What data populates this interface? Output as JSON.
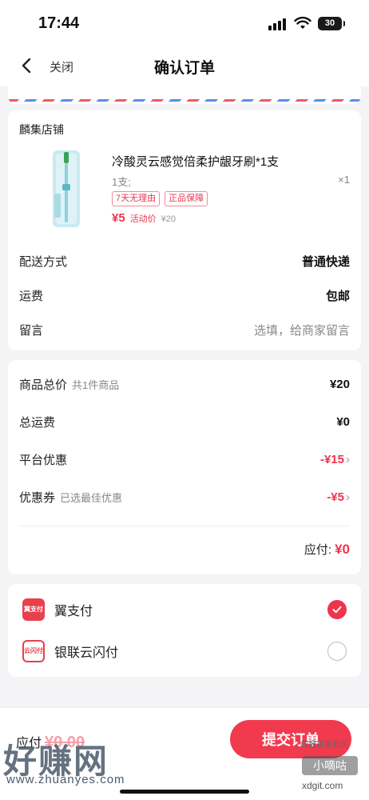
{
  "status_bar": {
    "time": "17:44",
    "battery": "30"
  },
  "nav": {
    "close_label": "关闭",
    "title": "确认订单"
  },
  "shop": {
    "name": "麟集店铺",
    "product": {
      "title": "冷酸灵云感觉倍柔护龈牙刷*1支",
      "spec": "1支;",
      "qty": "×1",
      "tags": [
        "7天无理由",
        "正品保障"
      ],
      "price": "¥5",
      "price_label": "活动价",
      "original_price": "¥20"
    },
    "delivery_label": "配送方式",
    "delivery_value": "普通快递",
    "shipping_label": "运费",
    "shipping_value": "包邮",
    "message_label": "留言",
    "message_placeholder": "选填，给商家留言"
  },
  "summary": {
    "goods_total_label": "商品总价",
    "goods_total_note": "共1件商品",
    "goods_total_value": "¥20",
    "shipping_total_label": "总运费",
    "shipping_total_value": "¥0",
    "platform_discount_label": "平台优惠",
    "platform_discount_value": "-¥15",
    "coupon_label": "优惠券",
    "coupon_note": "已选最佳优惠",
    "coupon_value": "-¥5",
    "due_label": "应付:",
    "due_value": "¥0"
  },
  "payment": {
    "methods": [
      {
        "name": "翼支付",
        "logo": "翼支付",
        "selected": true
      },
      {
        "name": "银联云闪付",
        "logo": "云闪付",
        "selected": false
      }
    ]
  },
  "bottom": {
    "due_label": "应付",
    "due_value": "¥0.00",
    "submit_label": "提交订单"
  },
  "watermarks": {
    "main": "好赚网",
    "url": "www.zhuanyes.com",
    "side_top": "线报首发社区",
    "side_badge": "小嘀咕",
    "side_url": "xdgit.com"
  },
  "colors": {
    "accent": "#f0344a",
    "background": "#f4f4f6"
  }
}
